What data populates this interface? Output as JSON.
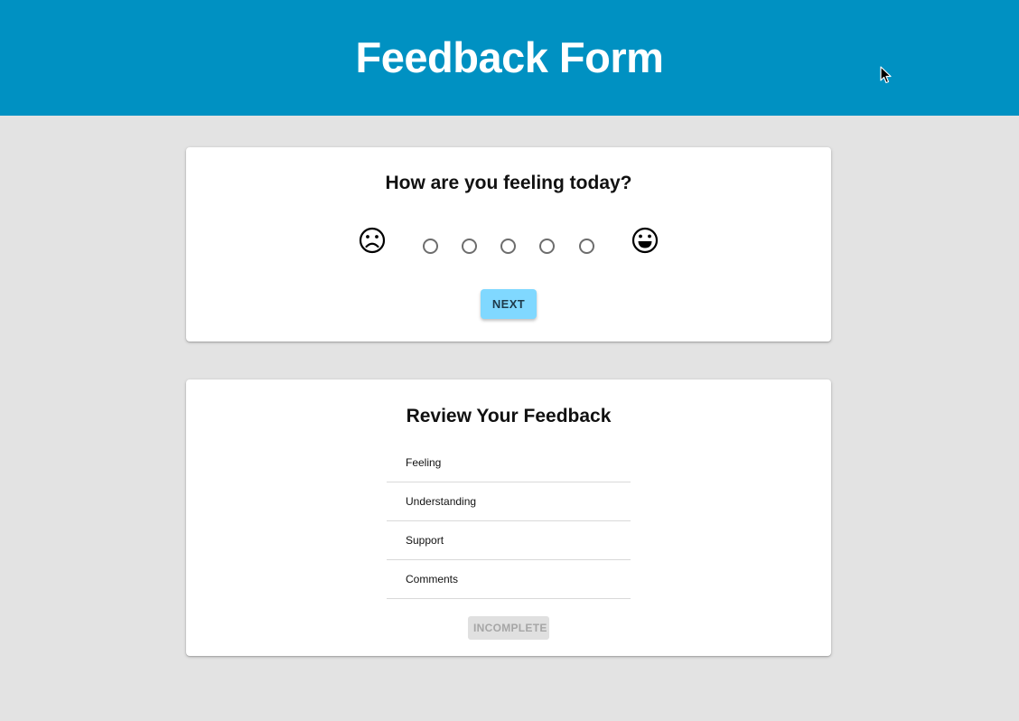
{
  "header": {
    "title": "Feedback Form"
  },
  "feeling_step": {
    "question": "How are you feeling today?",
    "low_icon": "frowning-face-icon",
    "high_icon": "smiling-face-icon",
    "options": [
      "1",
      "2",
      "3",
      "4",
      "5"
    ],
    "selected": null,
    "next_label": "NEXT"
  },
  "review": {
    "title": "Review Your Feedback",
    "items": [
      {
        "label": "Feeling"
      },
      {
        "label": "Understanding"
      },
      {
        "label": "Support"
      },
      {
        "label": "Comments"
      }
    ],
    "submit_label": "INCOMPLETE"
  },
  "colors": {
    "header_bg": "#0091c2",
    "page_bg": "#e3e3e3",
    "next_button_bg": "#80d8ff",
    "disabled_button_bg": "#e0e0e0"
  }
}
